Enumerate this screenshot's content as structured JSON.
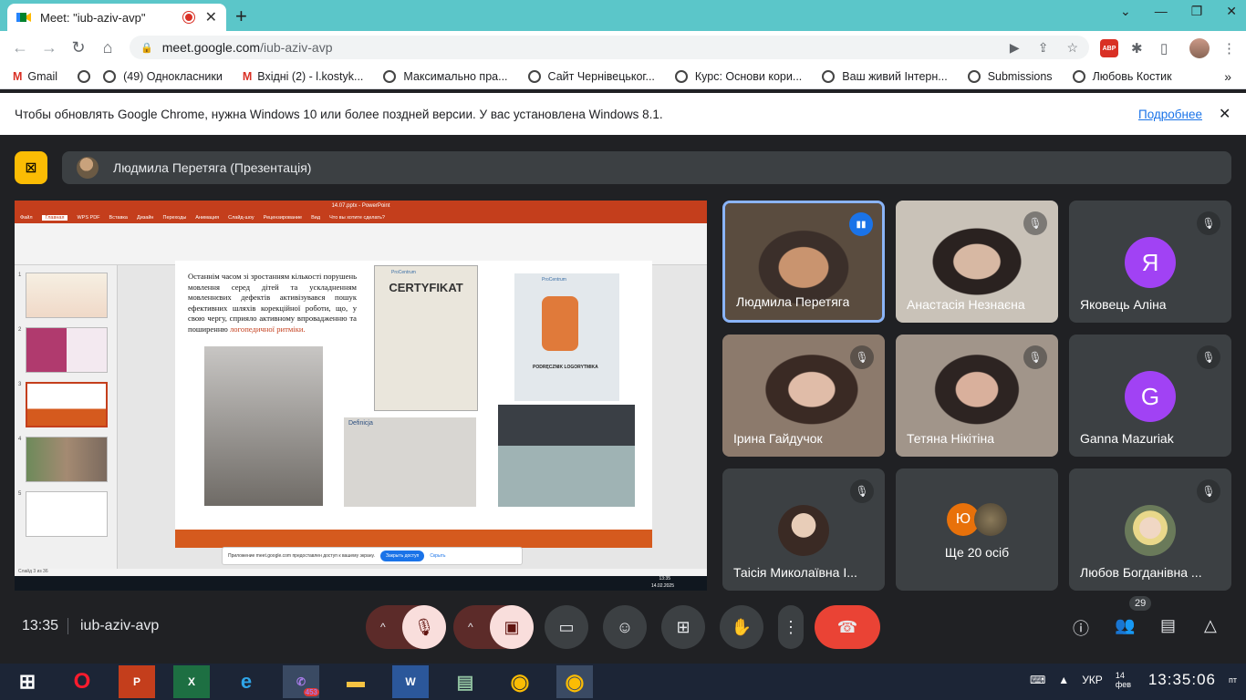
{
  "browser": {
    "tab_title": "Meet: \"iub-aziv-avp\"",
    "url_host": "meet.google.com",
    "url_path": "/iub-aziv-avp",
    "abp": "ABP"
  },
  "bookmarks": [
    "Gmail",
    "(49) Однокласники",
    "Вхідні (2) - l.kostyk...",
    "Максимально пра...",
    "Сайт Чернівецьког...",
    "Курс: Основи кори...",
    "Ваш живий Інтерн...",
    "Submissions",
    "Любовь Костик"
  ],
  "infobar": {
    "text": "Чтобы обновлять Google Chrome, нужна Windows 10 или более поздней версии. У вас установлена Windows 8.1.",
    "link": "Подробнее"
  },
  "presenter": {
    "label": "Людмила Перетяга (Презентація)"
  },
  "slide": {
    "window_title": "14.07.pptx - PowerPoint",
    "menu": [
      "Файл",
      "Главная",
      "WPS PDF",
      "Вставка",
      "Дизайн",
      "Переходы",
      "Анимация",
      "Слайд-шоу",
      "Рецензирование",
      "Вид",
      "Что вы хотите сделать?"
    ],
    "text_main": "Останнім часом зі зростанням кількості порушень мовлення серед дітей та ускладненням мовленнєвих дефектів активізувався пошук ефективних шляхів корекційної роботи, що, у свою чергу, сприяло активному впровадженню та поширенню",
    "text_red": "логопедичної ритміки.",
    "cert": "CERTYFIKAT",
    "brand": "ProCentrum",
    "book": "PODRĘCZNIK LOGORYTMIKA",
    "def": "Definicja",
    "share_msg": "Приложение meet.google.com предоставлен доступ к вашему экрану.",
    "share_btn": "Закрыть доступ",
    "share_hide": "Скрыть",
    "status": "Слайд 3 из 36",
    "time": "13:35",
    "date": "14.02.2025"
  },
  "participants": [
    {
      "name": "Людмила Перетяга",
      "speaking": true
    },
    {
      "name": "Анастасія Незнаєна",
      "muted": true
    },
    {
      "name": "Яковець Аліна",
      "letter": "Я",
      "color": "#a142f4",
      "muted": true
    },
    {
      "name": "Ірина Гайдучок",
      "muted": true
    },
    {
      "name": "Тетяна Нікітіна",
      "muted": true
    },
    {
      "name": "Ganna Mazuriak",
      "letter": "G",
      "color": "#a142f4",
      "muted": true
    },
    {
      "name": "Таісія Миколаївна І...",
      "muted": true
    },
    {
      "name": "Ще 20 осіб",
      "letter": "Ю"
    },
    {
      "name": "Любов Богданівна ...",
      "muted": true
    }
  ],
  "meet_bar": {
    "time": "13:35",
    "code": "iub-aziv-avp",
    "people_count": "29"
  },
  "taskbar": {
    "lang": "УКР",
    "time": "13:35:06",
    "day": "пт",
    "date": "14 фев",
    "viber_badge": "453"
  }
}
